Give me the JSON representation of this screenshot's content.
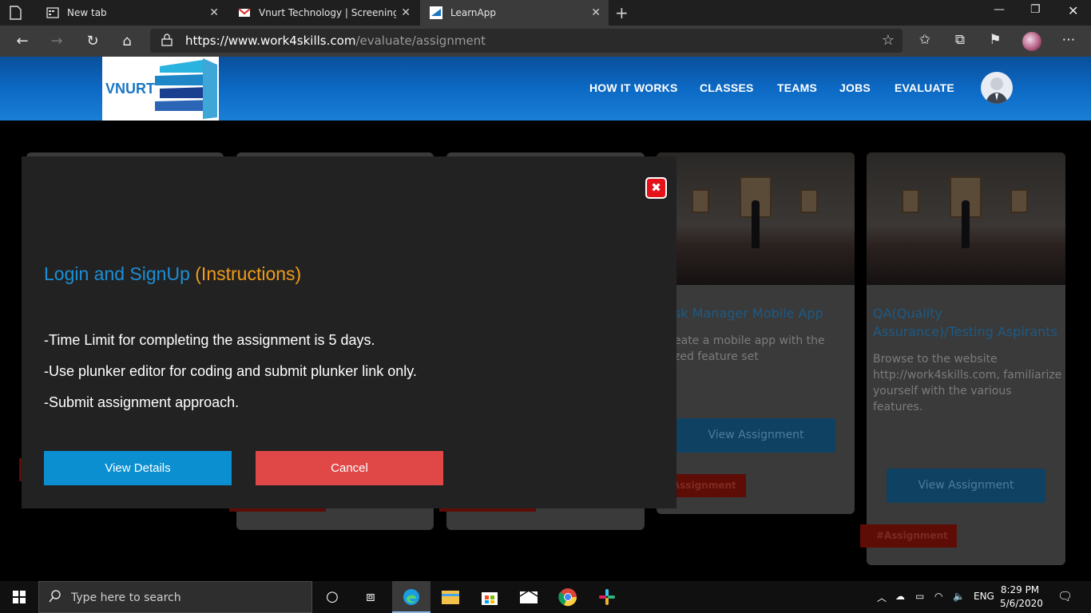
{
  "browser": {
    "tabs": [
      {
        "title": "New tab",
        "active": false
      },
      {
        "title": "Vnurt Technology | Screening Pro",
        "active": false
      },
      {
        "title": "LearnApp",
        "active": true
      }
    ],
    "url_host": "https://www.work4skills.com",
    "url_path": "/evaluate/assignment"
  },
  "site": {
    "logo_text": "VNURT",
    "nav": [
      "HOW IT WORKS",
      "CLASSES",
      "TEAMS",
      "JOBS",
      "EVALUATE"
    ]
  },
  "cards": [
    {
      "title": "sk Manager Mobile App",
      "desc": "eate a mobile app with the\nzed feature set",
      "button": "View Assignment",
      "tag": "Assignment"
    },
    {
      "title": "QA(Quality\nAssurance)/Testing Aspirants",
      "desc": "Browse to the website\nhttp://work4skills.com, familiarize\nyourself with the various\nfeatures.",
      "button": "View Assignment",
      "tag": "#Assignment"
    }
  ],
  "modal": {
    "close_symbol": "✖",
    "heading_main": "Login and SignUp",
    "heading_accent": "(Instructions)",
    "lines": [
      "-Time Limit for completing the assignment is 5 days.",
      "-Use plunker editor for coding and submit plunker link only.",
      "-Submit assignment approach."
    ],
    "view_details_label": "View Details",
    "cancel_label": "Cancel"
  },
  "taskbar": {
    "search_placeholder": "Type here to search",
    "language": "ENG",
    "time": "8:29 PM",
    "date": "5/6/2020"
  },
  "colors": {
    "header_blue": "#0c69c4",
    "modal_bg": "#222222",
    "heading_blue": "#1d8fd6",
    "heading_orange": "#f19c1b",
    "view_details_bg": "#0b8fd0",
    "cancel_bg": "#e04848",
    "close_red": "#e6121a"
  }
}
